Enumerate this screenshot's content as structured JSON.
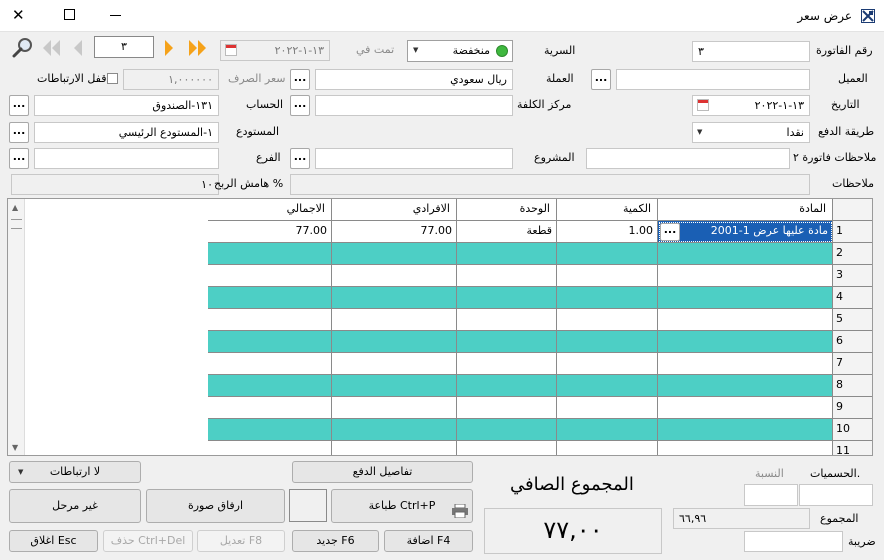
{
  "window": {
    "title": "عرض سعر",
    "minimize": "—",
    "maximize": "☐",
    "close": "✕"
  },
  "nav": {
    "record_number": "٣",
    "doc_date": "١٣-١-٢٠٢٢",
    "done_label": "تمت في"
  },
  "form": {
    "invoice_number_label": "رقم الفاتورة",
    "invoice_number": "٣",
    "secrecy_label": "السرية",
    "secrecy_value": "منخفضة",
    "customer_label": "العميل",
    "customer_value": "",
    "currency_label": "العملة",
    "currency_value": "ريال سعودي",
    "exchange_rate_label": "سعر الصرف",
    "exchange_rate_value": "١,٠٠٠٠٠٠",
    "lock_links_label": "قفل الارتباطات",
    "date_label": "التاريخ",
    "date_value": "١٣-١-٢٠٢٢",
    "cost_center_label": "مركز الكلفة",
    "cost_center_value": "",
    "account_label": "الحساب",
    "account_value": "١٣١-الصندوق",
    "payment_method_label": "طريقة الدفع",
    "payment_method_value": "نقدا",
    "warehouse_label": "المستودع",
    "warehouse_value": "١-المستودع الرئيسي",
    "invoice_notes2_label": "ملاحظات فاتورة ٢",
    "invoice_notes2_value": "",
    "project_label": "المشروع",
    "project_value": "",
    "branch_label": "الفرع",
    "branch_value": "",
    "notes_label": "ملاحظات",
    "notes_value": "",
    "profit_margin_label": "هامش الربح %",
    "profit_margin_value": "١٠",
    "dots": "..."
  },
  "grid": {
    "headers": {
      "item": "المادة",
      "quantity": "الكمية",
      "unit": "الوحدة",
      "unit_price": "الافرادي",
      "total": "الاجمالي"
    },
    "row_numbers": [
      "1",
      "2",
      "3",
      "4",
      "5",
      "6",
      "7",
      "8",
      "9",
      "10",
      "11"
    ],
    "first_row": {
      "item": "2001-مادة عليها عرض 1",
      "quantity": "1.00",
      "unit": "قطعة",
      "unit_price": "77.00",
      "total": "77.00"
    }
  },
  "footer": {
    "discounts_label": "الحسميات.",
    "percentage_label": "النسبة",
    "total_label": "المجموع",
    "total_value": "٦٦,٩٦",
    "tax_label": "ضريبة",
    "net_total_label": "المجموع الصافي",
    "net_total_value": "٧٧,٠٠",
    "payment_details_button": "تفاصيل الدفع",
    "no_links_dropdown": "لا ارتباطات",
    "print_button": "طباعة Ctrl+P",
    "attach_image_button": "ارفاق صورة",
    "unposted_button": "غير مرحل",
    "add_button": "اضافة F4",
    "new_button": "جديد F6",
    "edit_button": "تعديل F8",
    "delete_button": "حذف Ctrl+Del",
    "close_button": "اغلاق Esc"
  },
  "colors": {
    "row_highlight": "#4dcfc5",
    "status_green": "#3fb83f",
    "nav_orange": "#f5a21a"
  }
}
